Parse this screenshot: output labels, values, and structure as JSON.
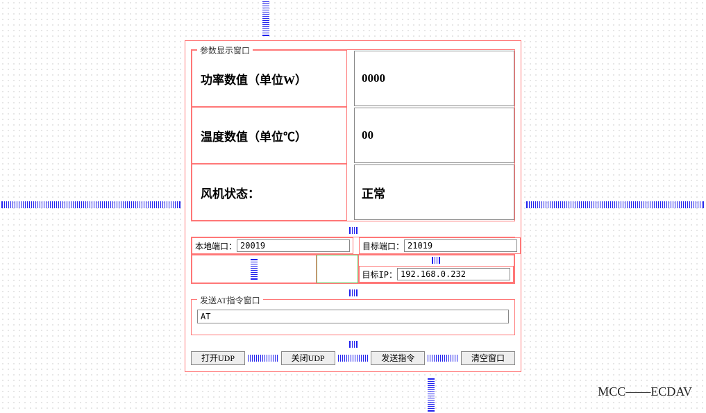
{
  "params_group_title": "参数显示窗口",
  "params": {
    "power_label": "功率数值（单位W）",
    "power_value": "0000",
    "temp_label": "温度数值（单位℃）",
    "temp_value": "00",
    "fan_label": "风机状态：",
    "fan_value": "正常"
  },
  "ports": {
    "local_label": "本地端口：",
    "local_value": "20019",
    "target_port_label": "目标端口：",
    "target_port_value": "21019",
    "target_ip_label": "目标IP：",
    "target_ip_value": "192.168.0.232"
  },
  "at_group_title": "发送AT指令窗口",
  "at_value": "AT",
  "buttons": {
    "open": "打开UDP",
    "close": "关闭UDP",
    "send": "发送指令",
    "clear": "清空窗口"
  },
  "footer": "MCC——ECDAV"
}
